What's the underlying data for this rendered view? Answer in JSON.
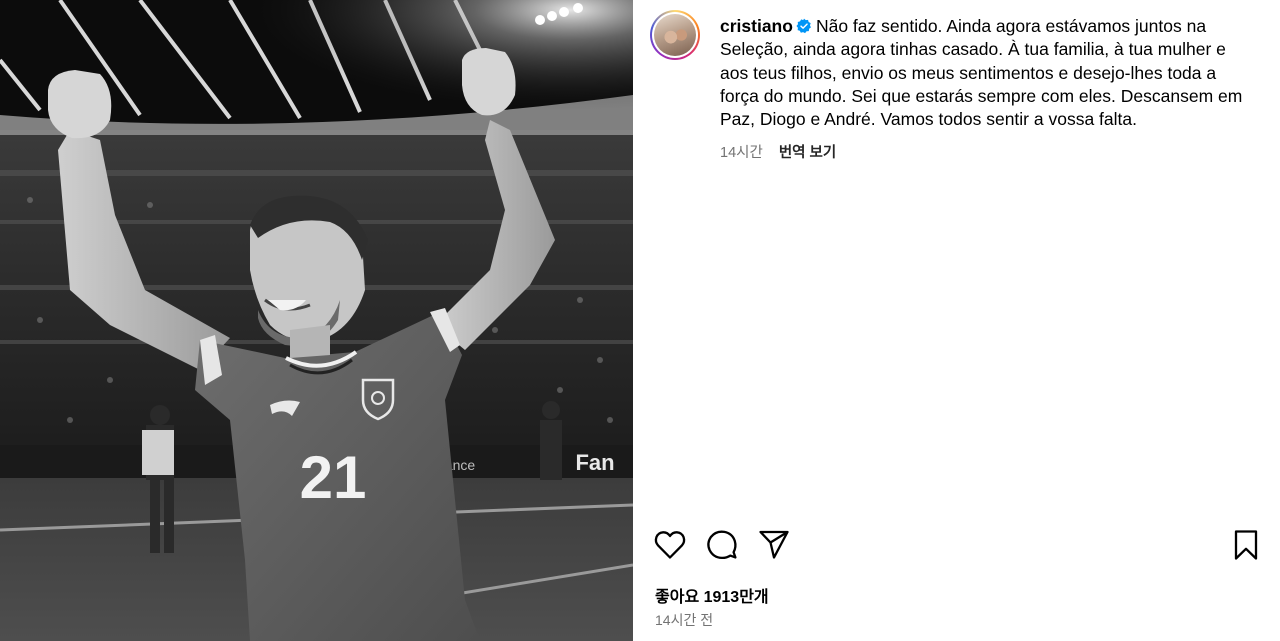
{
  "post": {
    "photo": {
      "jersey_number": "21",
      "board_text": "Fan"
    },
    "author": {
      "username": "cristiano",
      "verified": true,
      "verified_color": "#0095f6"
    },
    "caption": "Não faz sentido. Ainda agora estávamos juntos na Seleção, ainda agora tinhas casado. À tua familia, à tua mulher e aos teus filhos, envio os meus sentimentos e desejo-lhes toda a força do mundo. Sei que estarás sempre com eles. Descansem em Paz, Diogo e André. Vamos todos sentir a vossa falta.",
    "caption_time": "14시간",
    "translate_label": "번역 보기",
    "actions": {
      "like_icon": "heart-icon",
      "comment_icon": "comment-icon",
      "share_icon": "share-icon",
      "save_icon": "bookmark-icon"
    },
    "likes_text": "좋아요 1913만개",
    "posted_time": "14시간 전"
  }
}
